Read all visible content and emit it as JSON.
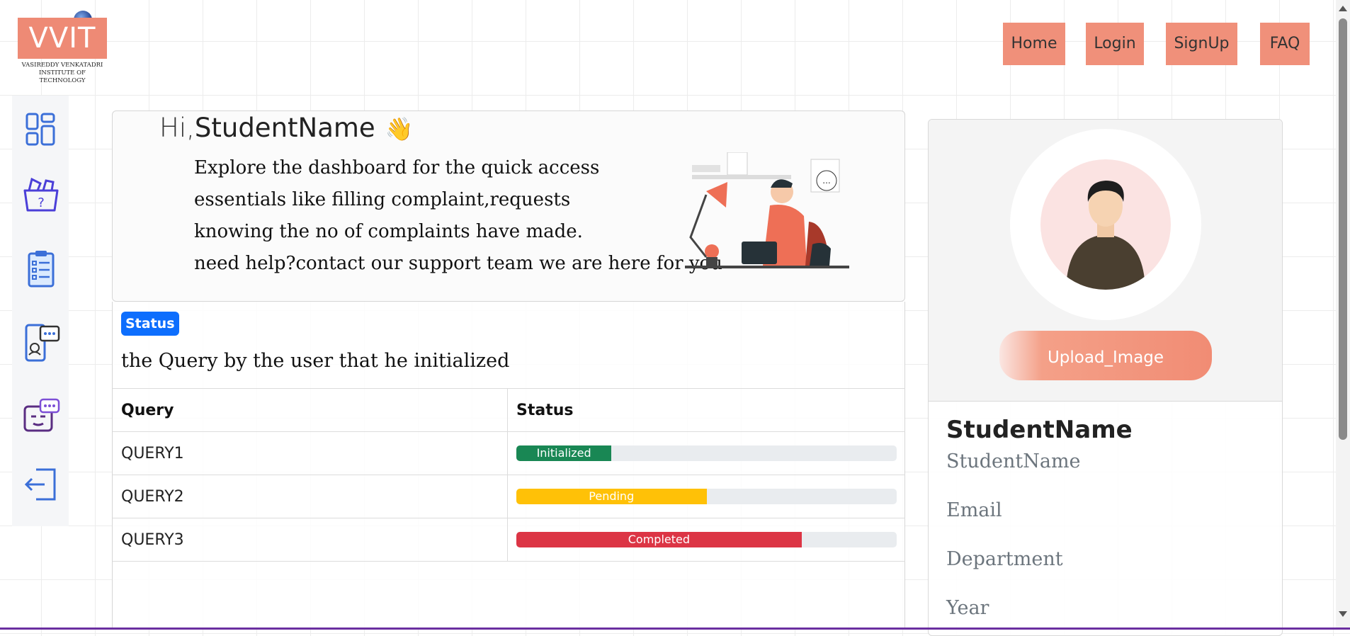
{
  "logo": {
    "text": "VVIT",
    "subtitle_line1": "VASIREDDY VENKATADRI",
    "subtitle_line2": "INSTITUTE OF TECHNOLOGY"
  },
  "nav": {
    "home": "Home",
    "login": "Login",
    "signup": "SignUp",
    "faq": "FAQ"
  },
  "sidebar": {
    "items": [
      {
        "icon": "dashboard-icon"
      },
      {
        "icon": "complaint-box-icon"
      },
      {
        "icon": "clipboard-list-icon"
      },
      {
        "icon": "phone-support-icon"
      },
      {
        "icon": "chatbot-icon"
      },
      {
        "icon": "logout-icon"
      }
    ]
  },
  "welcome": {
    "hi": "Hi,",
    "name": "StudentName",
    "wave": "👋",
    "lines": [
      "Explore the dashboard for the quick access",
      "essentials like filling complaint,requests",
      "knowing the no of complaints have made.",
      "need help?contact our support team we are here for you"
    ]
  },
  "status": {
    "badge": "Status",
    "description": "the Query by the user that he initialized",
    "headers": [
      "Query",
      "Status"
    ],
    "rows": [
      {
        "query": "QUERY1",
        "status": "Initialized",
        "progress": 25,
        "color": "#198754"
      },
      {
        "query": "QUERY2",
        "status": "Pending",
        "progress": 50,
        "color": "#ffc107"
      },
      {
        "query": "QUERY3",
        "status": "Completed",
        "progress": 75,
        "color": "#dc3545"
      }
    ]
  },
  "profile": {
    "upload_label": "Upload_Image",
    "name": "StudentName",
    "fields": [
      "StudentName",
      "Email",
      "Department",
      "Year"
    ]
  },
  "colors": {
    "accent": "#f0907a",
    "primary": "#0d6efd"
  }
}
